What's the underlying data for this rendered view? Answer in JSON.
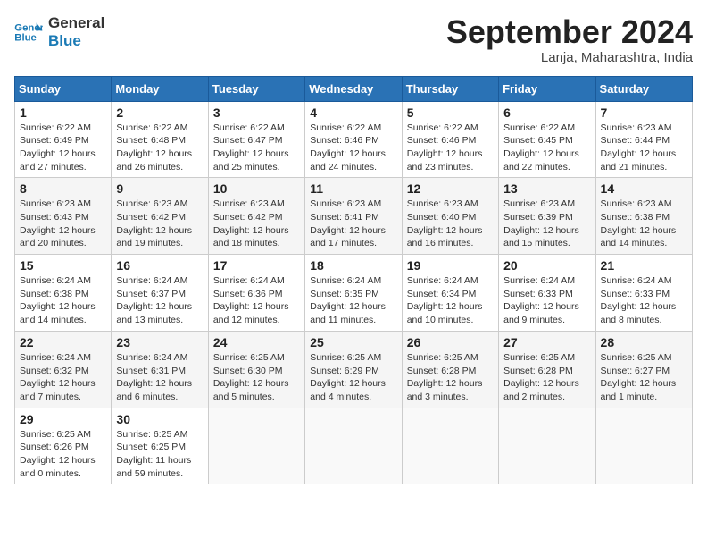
{
  "header": {
    "logo_line1": "General",
    "logo_line2": "Blue",
    "month": "September 2024",
    "location": "Lanja, Maharashtra, India"
  },
  "weekdays": [
    "Sunday",
    "Monday",
    "Tuesday",
    "Wednesday",
    "Thursday",
    "Friday",
    "Saturday"
  ],
  "weeks": [
    [
      {
        "day": 1,
        "rise": "6:22 AM",
        "set": "6:49 PM",
        "daylight": "12 hours and 27 minutes."
      },
      {
        "day": 2,
        "rise": "6:22 AM",
        "set": "6:48 PM",
        "daylight": "12 hours and 26 minutes."
      },
      {
        "day": 3,
        "rise": "6:22 AM",
        "set": "6:47 PM",
        "daylight": "12 hours and 25 minutes."
      },
      {
        "day": 4,
        "rise": "6:22 AM",
        "set": "6:46 PM",
        "daylight": "12 hours and 24 minutes."
      },
      {
        "day": 5,
        "rise": "6:22 AM",
        "set": "6:46 PM",
        "daylight": "12 hours and 23 minutes."
      },
      {
        "day": 6,
        "rise": "6:22 AM",
        "set": "6:45 PM",
        "daylight": "12 hours and 22 minutes."
      },
      {
        "day": 7,
        "rise": "6:23 AM",
        "set": "6:44 PM",
        "daylight": "12 hours and 21 minutes."
      }
    ],
    [
      {
        "day": 8,
        "rise": "6:23 AM",
        "set": "6:43 PM",
        "daylight": "12 hours and 20 minutes."
      },
      {
        "day": 9,
        "rise": "6:23 AM",
        "set": "6:42 PM",
        "daylight": "12 hours and 19 minutes."
      },
      {
        "day": 10,
        "rise": "6:23 AM",
        "set": "6:42 PM",
        "daylight": "12 hours and 18 minutes."
      },
      {
        "day": 11,
        "rise": "6:23 AM",
        "set": "6:41 PM",
        "daylight": "12 hours and 17 minutes."
      },
      {
        "day": 12,
        "rise": "6:23 AM",
        "set": "6:40 PM",
        "daylight": "12 hours and 16 minutes."
      },
      {
        "day": 13,
        "rise": "6:23 AM",
        "set": "6:39 PM",
        "daylight": "12 hours and 15 minutes."
      },
      {
        "day": 14,
        "rise": "6:23 AM",
        "set": "6:38 PM",
        "daylight": "12 hours and 14 minutes."
      }
    ],
    [
      {
        "day": 15,
        "rise": "6:24 AM",
        "set": "6:38 PM",
        "daylight": "12 hours and 14 minutes."
      },
      {
        "day": 16,
        "rise": "6:24 AM",
        "set": "6:37 PM",
        "daylight": "12 hours and 13 minutes."
      },
      {
        "day": 17,
        "rise": "6:24 AM",
        "set": "6:36 PM",
        "daylight": "12 hours and 12 minutes."
      },
      {
        "day": 18,
        "rise": "6:24 AM",
        "set": "6:35 PM",
        "daylight": "12 hours and 11 minutes."
      },
      {
        "day": 19,
        "rise": "6:24 AM",
        "set": "6:34 PM",
        "daylight": "12 hours and 10 minutes."
      },
      {
        "day": 20,
        "rise": "6:24 AM",
        "set": "6:33 PM",
        "daylight": "12 hours and 9 minutes."
      },
      {
        "day": 21,
        "rise": "6:24 AM",
        "set": "6:33 PM",
        "daylight": "12 hours and 8 minutes."
      }
    ],
    [
      {
        "day": 22,
        "rise": "6:24 AM",
        "set": "6:32 PM",
        "daylight": "12 hours and 7 minutes."
      },
      {
        "day": 23,
        "rise": "6:24 AM",
        "set": "6:31 PM",
        "daylight": "12 hours and 6 minutes."
      },
      {
        "day": 24,
        "rise": "6:25 AM",
        "set": "6:30 PM",
        "daylight": "12 hours and 5 minutes."
      },
      {
        "day": 25,
        "rise": "6:25 AM",
        "set": "6:29 PM",
        "daylight": "12 hours and 4 minutes."
      },
      {
        "day": 26,
        "rise": "6:25 AM",
        "set": "6:28 PM",
        "daylight": "12 hours and 3 minutes."
      },
      {
        "day": 27,
        "rise": "6:25 AM",
        "set": "6:28 PM",
        "daylight": "12 hours and 2 minutes."
      },
      {
        "day": 28,
        "rise": "6:25 AM",
        "set": "6:27 PM",
        "daylight": "12 hours and 1 minute."
      }
    ],
    [
      {
        "day": 29,
        "rise": "6:25 AM",
        "set": "6:26 PM",
        "daylight": "12 hours and 0 minutes."
      },
      {
        "day": 30,
        "rise": "6:25 AM",
        "set": "6:25 PM",
        "daylight": "11 hours and 59 minutes."
      },
      null,
      null,
      null,
      null,
      null
    ]
  ]
}
